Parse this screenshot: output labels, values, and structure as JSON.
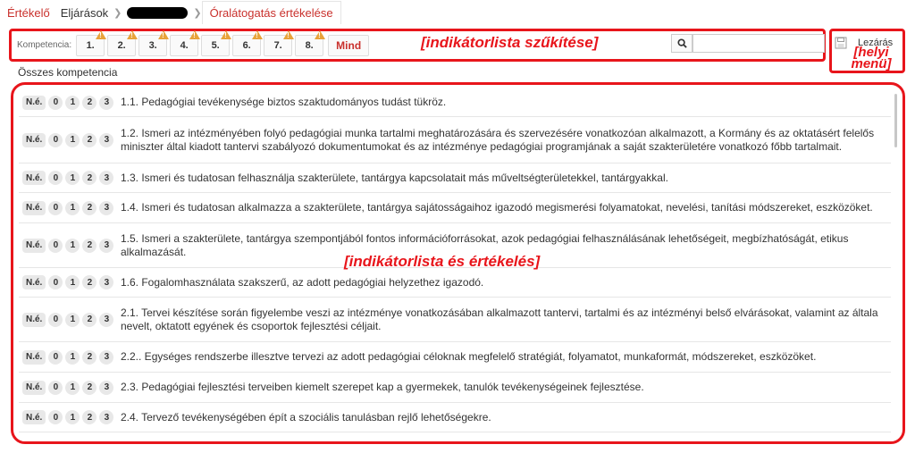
{
  "breadcrumb": {
    "root": "Értékelő",
    "procedures": "Eljárások",
    "current": "Óralátogatás értékelése"
  },
  "toolbar": {
    "kompetencia_label": "Kompetencia:",
    "buttons": [
      "1.",
      "2.",
      "3.",
      "4.",
      "5.",
      "6.",
      "7.",
      "8."
    ],
    "all_label": "Mind",
    "annotation": "[indikátorlista szűkítése]",
    "search_placeholder": ""
  },
  "local_menu": {
    "close_label": "Lezárás",
    "annotation_line1": "[helyi",
    "annotation_line2": "menü]"
  },
  "section_title": "Összes kompetencia",
  "list_annotation": "[indikátorlista és értékelés]",
  "rating_labels": [
    "N.é.",
    "0",
    "1",
    "2",
    "3"
  ],
  "indicators": [
    "1.1. Pedagógiai tevékenysége biztos szaktudományos tudást tükröz.",
    "1.2. Ismeri az intézményében folyó pedagógiai munka tartalmi meghatározására és szervezésére vonatkozóan alkalmazott, a Kormány és az oktatásért felelős miniszter által kiadott tantervi szabályozó dokumentumokat és az intézménye pedagógiai programjának a saját szakterületére vonatkozó főbb tartalmait.",
    "1.3. Ismeri és tudatosan felhasználja szakterülete, tantárgya kapcsolatait más műveltségterületekkel, tantárgyakkal.",
    "1.4. Ismeri és tudatosan alkalmazza a szakterülete, tantárgya sajátosságaihoz igazodó megismerési folyamatokat, nevelési, tanítási módszereket, eszközöket.",
    "1.5. Ismeri a szakterülete, tantárgya szempontjából fontos információforrásokat, azok pedagógiai felhasználásának lehetőségeit, megbízhatóságát, etikus alkalmazását.",
    "1.6. Fogalomhasználata szakszerű, az adott pedagógiai helyzethez igazodó.",
    "2.1. Tervei készítése során figyelembe veszi az intézménye vonatkozásában alkalmazott tantervi, tartalmi és az intézményi belső elvárásokat, valamint az általa nevelt, oktatott egyének és csoportok fejlesztési céljait.",
    "2.2.. Egységes rendszerbe illesztve tervezi az adott pedagógiai céloknak megfelelő stratégiát, folyamatot, munkaformát, módszereket, eszközöket.",
    "2.3. Pedagógiai fejlesztési terveiben kiemelt szerepet kap a gyermekek, tanulók tevékenységeinek fejlesztése.",
    "2.4. Tervező tevékenységében épít a szociális tanulásban rejlő lehetőségekre."
  ]
}
